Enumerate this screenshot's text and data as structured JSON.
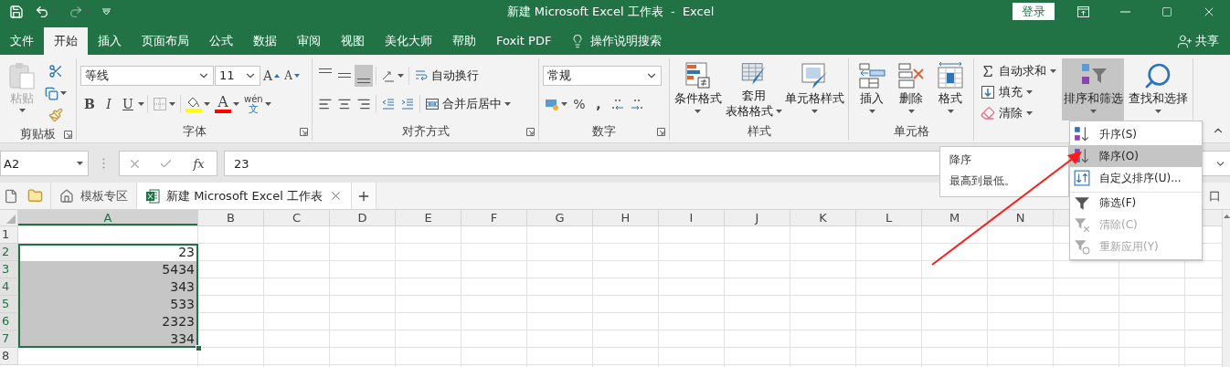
{
  "title_bar": {
    "title": "新建 Microsoft Excel 工作表  -  Excel",
    "redo": {
      "disabled": true
    },
    "sign_in": "登录"
  },
  "menu_tabs": [
    {
      "label": "文件",
      "selected": false
    },
    {
      "label": "开始",
      "selected": true
    },
    {
      "label": "插入",
      "selected": false
    },
    {
      "label": "页面布局",
      "selected": false
    },
    {
      "label": "公式",
      "selected": false
    },
    {
      "label": "数据",
      "selected": false
    },
    {
      "label": "审阅",
      "selected": false
    },
    {
      "label": "视图",
      "selected": false
    },
    {
      "label": "美化大师",
      "selected": false
    },
    {
      "label": "帮助",
      "selected": false
    },
    {
      "label": "Foxit PDF",
      "selected": false
    }
  ],
  "tell_me": "操作说明搜索",
  "share": "共享",
  "ribbon": {
    "clipboard": {
      "label": "剪贴板",
      "paste": {
        "label": "粘贴",
        "disabled": true
      }
    },
    "font": {
      "label": "字体",
      "font_name": "等线",
      "font_size": "11",
      "grow": "A",
      "shrink": "A",
      "bold": "B",
      "italic": "I",
      "underline": "U",
      "font_color": "A",
      "phonetic_top": "wén",
      "phonetic_bottom": "文"
    },
    "alignment": {
      "label": "对齐方式",
      "vertical_align": [
        {
          "selected": false
        },
        {
          "selected": false
        },
        {
          "selected": true
        }
      ],
      "wrap_text": "自动换行",
      "merge_center": "合并后居中"
    },
    "number": {
      "label": "数字",
      "format": "常规",
      "percent": "%",
      "comma": ","
    },
    "styles": {
      "label": "样式",
      "buttons": [
        {
          "lines": [
            "条件格式"
          ]
        },
        {
          "lines": [
            "套用",
            "表格格式"
          ]
        },
        {
          "lines": [
            "单元格样式"
          ]
        }
      ]
    },
    "cells": {
      "label": "单元格",
      "buttons": [
        {
          "lines": [
            "插入"
          ]
        },
        {
          "lines": [
            "删除"
          ]
        },
        {
          "lines": [
            "格式"
          ]
        }
      ]
    },
    "editing": {
      "small_buttons": [
        {
          "label": "自动求和"
        },
        {
          "label": "填充"
        },
        {
          "label": "清除"
        }
      ],
      "sort_filter": {
        "label": "排序和筛选",
        "expanded": true
      },
      "find_select": {
        "label": "查找和选择"
      }
    }
  },
  "formula_bar": {
    "name_box": "A2",
    "fx": "fx",
    "formula": "23"
  },
  "doc_tabs": [
    {
      "label": "模板专区",
      "selected": false,
      "kind": "home"
    },
    {
      "label": "新建 Microsoft Excel 工作表",
      "selected": true,
      "kind": "workbook"
    }
  ],
  "doc_bar_right": "口",
  "sheet": {
    "columns": [
      {
        "label": "A",
        "selected": true
      },
      {
        "label": "B",
        "selected": false
      },
      {
        "label": "C",
        "selected": false
      },
      {
        "label": "D",
        "selected": false
      },
      {
        "label": "E",
        "selected": false
      },
      {
        "label": "F",
        "selected": false
      },
      {
        "label": "G",
        "selected": false
      },
      {
        "label": "H",
        "selected": false
      },
      {
        "label": "I",
        "selected": false
      },
      {
        "label": "J",
        "selected": false
      },
      {
        "label": "K",
        "selected": false
      },
      {
        "label": "L",
        "selected": false
      },
      {
        "label": "M",
        "selected": false
      },
      {
        "label": "N",
        "selected": false
      }
    ],
    "rows": [
      {
        "number": "1",
        "selected": false,
        "active": false
      },
      {
        "number": "2",
        "selected": true,
        "active": true,
        "value": "23"
      },
      {
        "number": "3",
        "selected": true,
        "active": false,
        "value": "5434"
      },
      {
        "number": "4",
        "selected": true,
        "active": false,
        "value": "343"
      },
      {
        "number": "5",
        "selected": true,
        "active": false,
        "value": "533"
      },
      {
        "number": "6",
        "selected": true,
        "active": false,
        "value": "2323"
      },
      {
        "number": "7",
        "selected": true,
        "active": false,
        "value": "334"
      },
      {
        "number": "8",
        "selected": false,
        "active": false
      }
    ]
  },
  "tooltip": {
    "title": "降序",
    "text": "最高到最低。"
  },
  "sort_menu": [
    {
      "label": "升序(S)",
      "kind": "ascending",
      "selected": false,
      "disabled": false,
      "separator_before": false
    },
    {
      "label": "降序(O)",
      "kind": "descending",
      "selected": true,
      "disabled": false,
      "separator_before": false
    },
    {
      "label": "自定义排序(U)...",
      "kind": "custom",
      "selected": false,
      "disabled": false,
      "separator_before": false
    },
    {
      "label": "筛选(F)",
      "kind": "filter",
      "selected": false,
      "disabled": false,
      "separator_before": true
    },
    {
      "label": "清除(C)",
      "kind": "clear",
      "selected": false,
      "disabled": true,
      "separator_before": false
    },
    {
      "label": "重新应用(Y)",
      "kind": "reapply",
      "selected": false,
      "disabled": true,
      "separator_before": false
    }
  ]
}
